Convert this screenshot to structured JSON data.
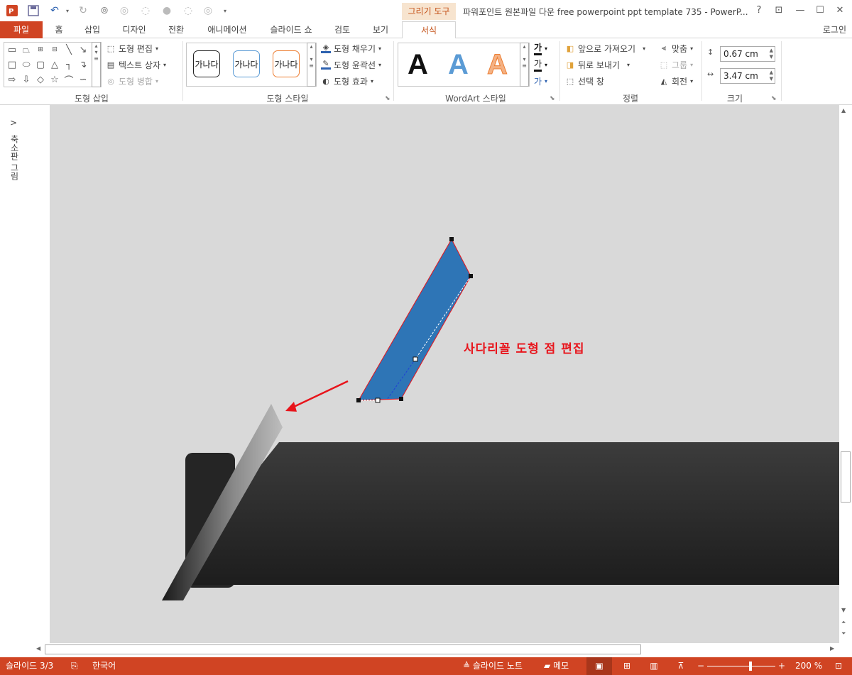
{
  "app": {
    "window_title": "파워포인트 원본파일 다운 free powerpoint ppt template 735 - PowerP...",
    "contextual_tab_group": "그리기 도구",
    "login": "로그인",
    "help": "?",
    "icons": {
      "app": "powerpoint-logo-icon",
      "save": "save-icon",
      "undo": "undo-icon",
      "redo": "redo-icon"
    }
  },
  "tabs": [
    "파일",
    "홈",
    "삽입",
    "디자인",
    "전환",
    "애니메이션",
    "슬라이드 쇼",
    "검토",
    "보기",
    "서식"
  ],
  "ribbon": {
    "insert_shapes": {
      "label": "도형 삽입",
      "edit_shape": "도형 편집",
      "text_box": "텍스트 상자",
      "merge_shapes": "도형 병합"
    },
    "shape_styles": {
      "label": "도형 스타일",
      "sample_text": "가나다",
      "fill": "도형 채우기",
      "outline": "도형 윤곽선",
      "effects": "도형 효과"
    },
    "wordart": {
      "label": "WordArt 스타일",
      "sample": "A",
      "text_fill_glyph": "가",
      "text_outline_glyph": "가",
      "text_effects_glyph": "가"
    },
    "arrange": {
      "label": "정렬",
      "bring_forward": "앞으로 가져오기",
      "send_backward": "뒤로 보내기",
      "selection_pane": "선택 창",
      "align": "맞춤",
      "group": "그룹",
      "rotate": "회전"
    },
    "size": {
      "label": "크기",
      "height": "0.67 cm",
      "width": "3.47 cm"
    }
  },
  "thumbnail_pane": {
    "label": "축소판 그림",
    "expand": ">"
  },
  "slide": {
    "annotation": "사다리꼴 도형 점 편집",
    "annotation_color": "#e8141b",
    "shape_fill": "#2e75b6"
  },
  "status": {
    "slide_counter": "슬라이드 3/3",
    "language": "한국어",
    "notes": "슬라이드 노트",
    "comments": "메모",
    "zoom": "200 %",
    "bar_color": "#d04423"
  }
}
